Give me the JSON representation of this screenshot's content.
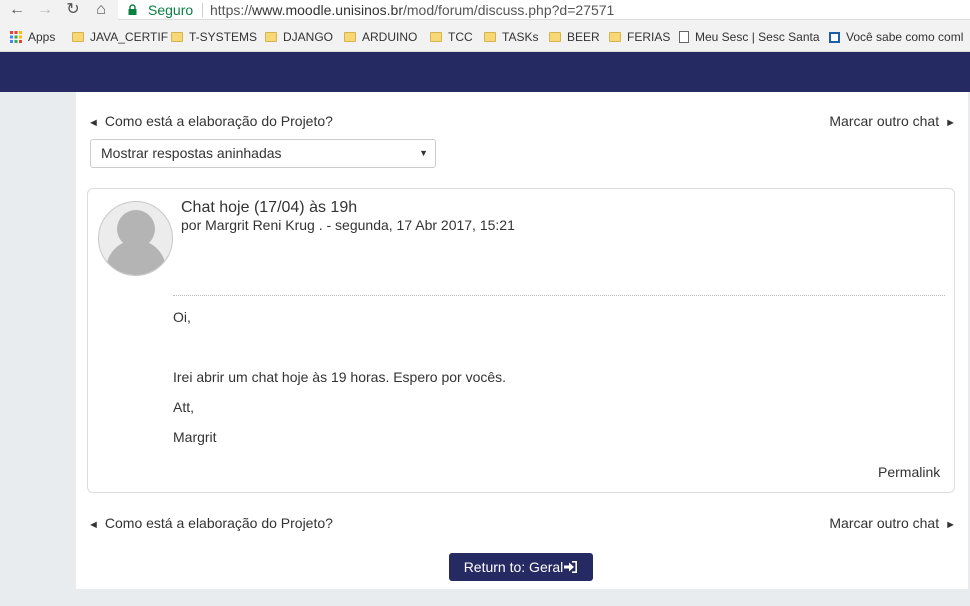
{
  "browser": {
    "secure_label": "Seguro",
    "url_prefix": "https://",
    "url_host": "www.moodle.unisinos.br",
    "url_path": "/mod/forum/discuss.php?d=27571"
  },
  "bookmarks": [
    {
      "label": "Apps",
      "icon": "apps-grid-icon"
    },
    {
      "label": "JAVA_CERTIF",
      "icon": "folder-icon"
    },
    {
      "label": "T-SYSTEMS",
      "icon": "folder-icon"
    },
    {
      "label": "DJANGO",
      "icon": "folder-icon"
    },
    {
      "label": "ARDUINO",
      "icon": "folder-icon"
    },
    {
      "label": "TCC",
      "icon": "folder-icon"
    },
    {
      "label": "TASKs",
      "icon": "folder-icon"
    },
    {
      "label": "BEER",
      "icon": "folder-icon"
    },
    {
      "label": "FERIAS",
      "icon": "folder-icon"
    },
    {
      "label": "Meu Sesc | Sesc Santa",
      "icon": "page-icon"
    },
    {
      "label": "Você sabe como coml",
      "icon": "site-icon"
    }
  ],
  "discussion_nav": {
    "prev_label": "Como está a elaboração do Projeto?",
    "next_label": "Marcar outro chat"
  },
  "display_mode": {
    "selected": "Mostrar respostas aninhadas"
  },
  "post": {
    "subject": "Chat hoje (17/04) às 19h",
    "author_line": "por Margrit Reni Krug . - segunda, 17 Abr 2017, 15:21",
    "body": [
      "Oi,",
      "Irei abrir um chat hoje às 19 horas. Espero por vocês.",
      "Att,",
      "Margrit"
    ],
    "permalink": "Permalink"
  },
  "return_button": "Return to: Geral",
  "colors": {
    "brand_navy": "#262a63",
    "secure_green": "#0b8043"
  }
}
